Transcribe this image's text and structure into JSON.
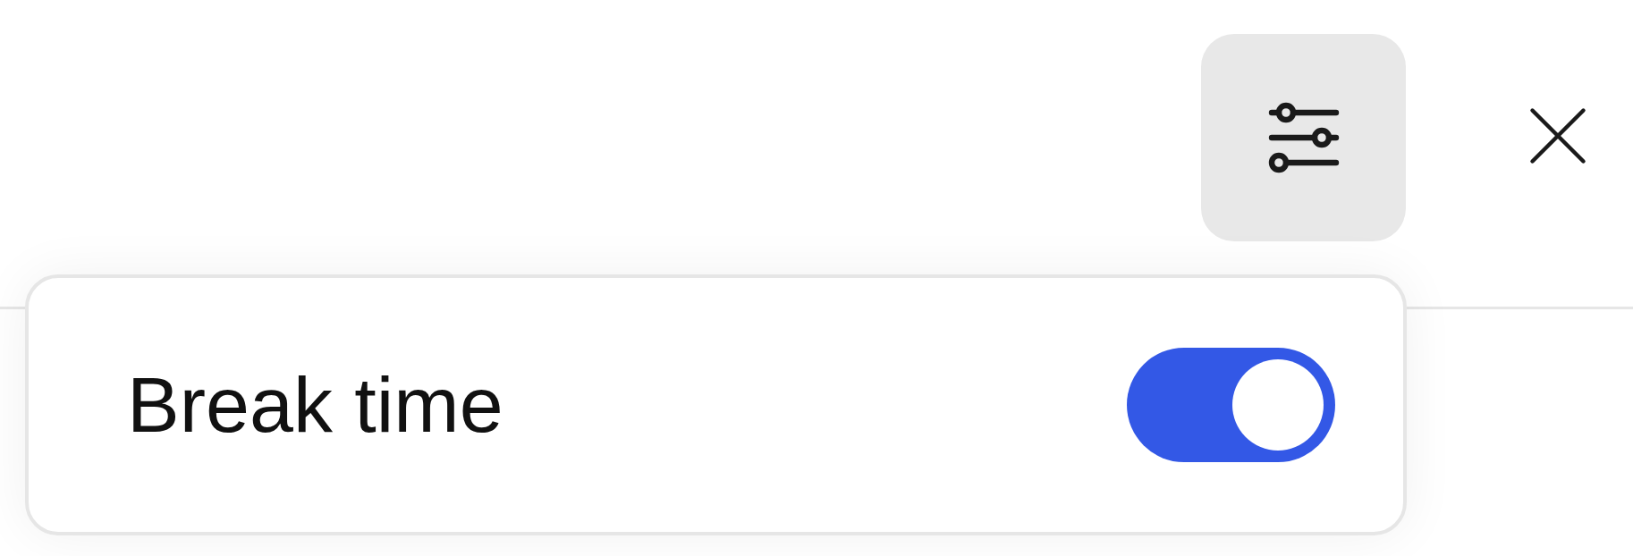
{
  "settings": [
    {
      "label": "Break time",
      "on": true
    }
  ]
}
